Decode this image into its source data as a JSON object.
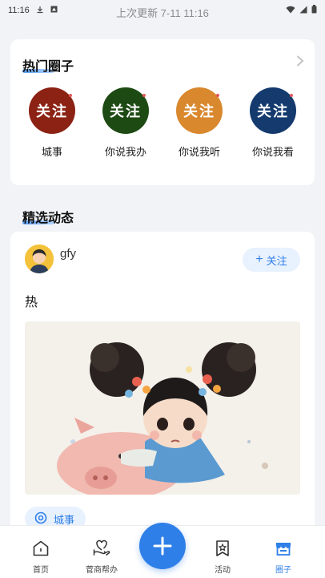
{
  "status_bar": {
    "time": "11:16"
  },
  "refresh_hint": "上次更新 7-11 11:16",
  "hot_circles": {
    "title": "热门圈子",
    "items": [
      {
        "badge": "关注",
        "name": "城事",
        "color": "#8b2214"
      },
      {
        "badge": "关注",
        "name": "你说我办",
        "color": "#1d4a13"
      },
      {
        "badge": "关注",
        "name": "你说我听",
        "color": "#d9882e"
      },
      {
        "badge": "关注",
        "name": "你说我看",
        "color": "#143a6e"
      }
    ]
  },
  "featured": {
    "title": "精选动态",
    "post": {
      "username": "gfy",
      "follow_label": "关注",
      "text": "热",
      "tag": "城事"
    }
  },
  "bottom_nav": {
    "items": [
      {
        "label": "首页"
      },
      {
        "label": "菅商帮办"
      },
      {
        "label": "活动"
      },
      {
        "label": "圈子"
      }
    ],
    "active_color": "#2f7fe8"
  }
}
